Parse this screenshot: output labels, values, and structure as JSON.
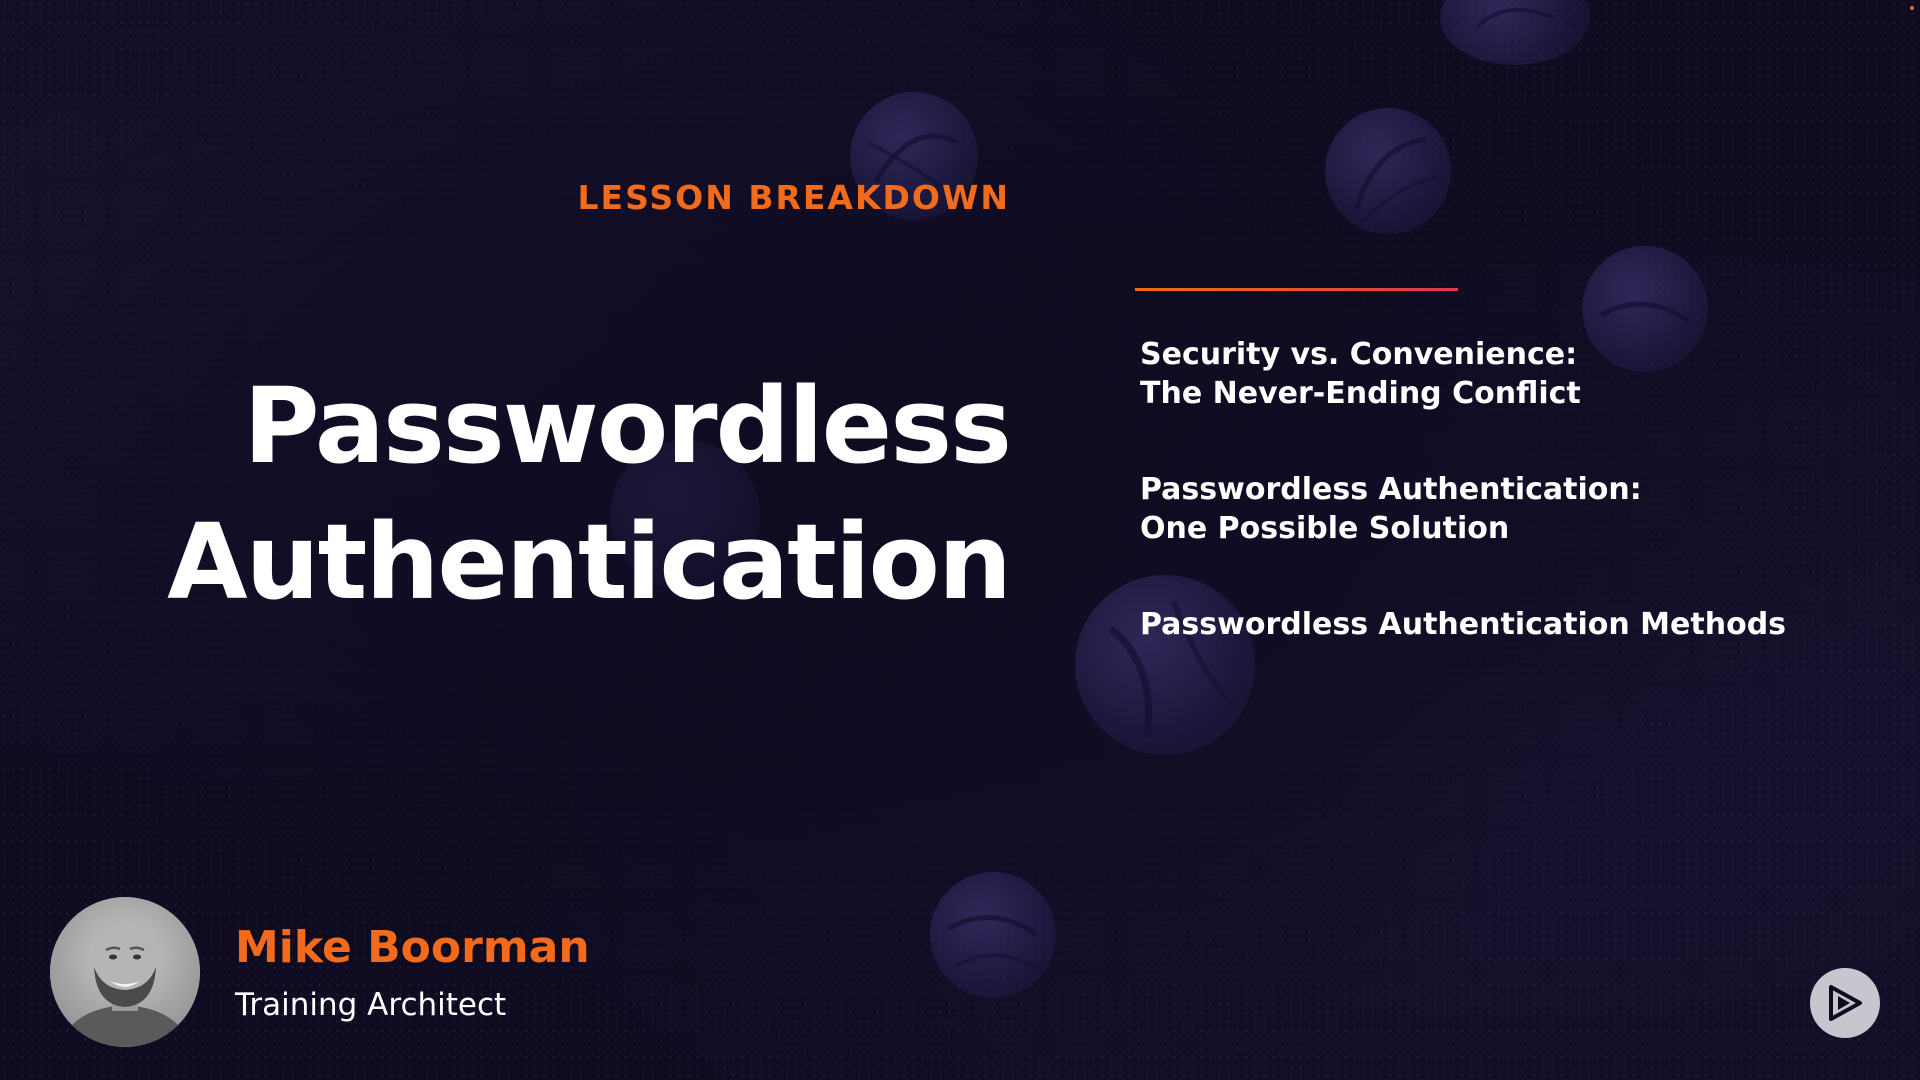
{
  "slide": {
    "eyebrow": "LESSON BREAKDOWN",
    "title_line1": "Passwordless",
    "title_line2": "Authentication",
    "topics": [
      {
        "line1": "Security vs. Convenience:",
        "line2": "The Never-Ending Conflict"
      },
      {
        "line1": "Passwordless Authentication:",
        "line2": "One Possible Solution"
      },
      {
        "line1": "Passwordless Authentication Methods",
        "line2": ""
      }
    ]
  },
  "presenter": {
    "name": "Mike Boorman",
    "role": "Training Architect"
  },
  "theme": {
    "background": "#0f0c22",
    "accent": "#f26a1b",
    "accent_gradient_end": "#e8344e",
    "text": "#ffffff"
  },
  "icons": {
    "avatar": "presenter-portrait",
    "logo": "play-triangle-logo-icon"
  }
}
